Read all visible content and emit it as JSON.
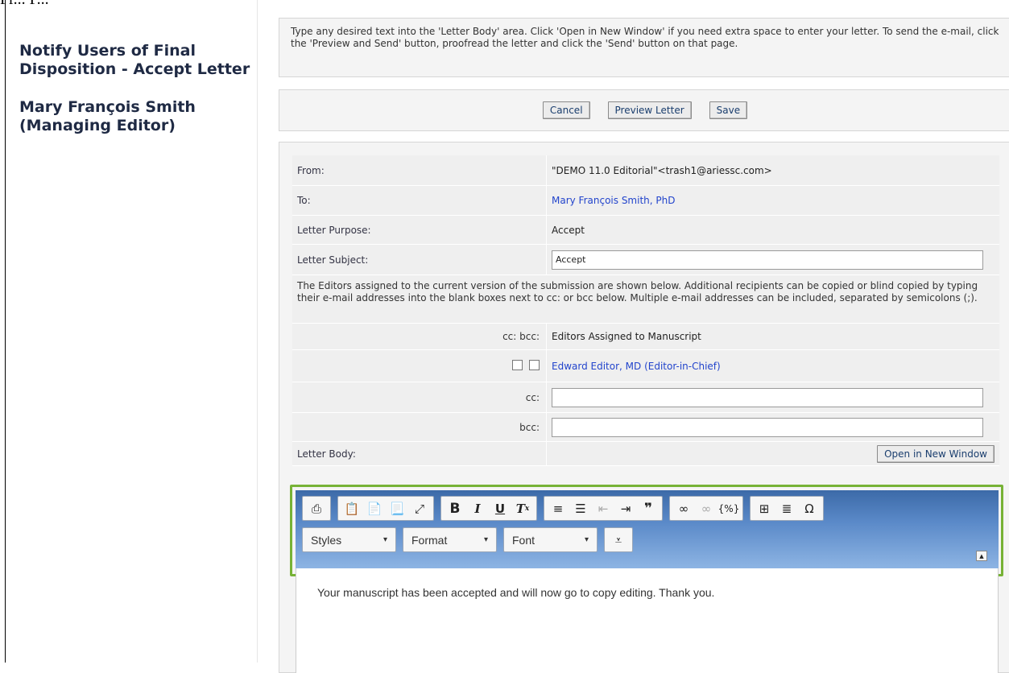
{
  "header_fragment": "Pr... P...",
  "sidebar": {
    "title": "Notify Users of Final Disposition - Accept Letter",
    "user": "Mary François Smith (Managing Editor)"
  },
  "instructions": "Type any desired text into the 'Letter Body' area. Click 'Open in New Window' if you need extra space to enter your letter. To send the e-mail, click the 'Preview and Send' button, proofread the letter and click the 'Send' button on that page.",
  "actions": {
    "cancel": "Cancel",
    "preview": "Preview Letter",
    "save": "Save"
  },
  "form": {
    "from_label": "From:",
    "from_value": "\"DEMO 11.0 Editorial\"<trash1@ariessc.com>",
    "to_label": "To:",
    "to_value": "Mary François Smith, PhD",
    "purpose_label": "Letter Purpose:",
    "purpose_value": "Accept",
    "subject_label": "Letter Subject:",
    "subject_value": "Accept",
    "editors_note": "The Editors assigned to the current version of the submission are shown below. Additional recipients can be copied or blind copied by typing their e-mail addresses into the blank boxes next to cc: or bcc below. Multiple e-mail addresses can be included, separated by semicolons (;).",
    "cc_bcc_header": "cc: bcc:",
    "editors_assigned": "Editors Assigned to Manuscript",
    "editor_name": "Edward Editor, MD (Editor-in-Chief)",
    "cc_label": "cc:",
    "cc_value": "",
    "bcc_label": "bcc:",
    "bcc_value": "",
    "body_label": "Letter Body:",
    "open_window": "Open in New Window"
  },
  "editor": {
    "styles": "Styles",
    "format": "Format",
    "font": "Font",
    "body_text": "Your manuscript has been accepted and will now go to copy editing. Thank you."
  },
  "colors": {
    "link": "#2244cc",
    "highlight": "#77b236",
    "toolbar": "#4a78b8"
  }
}
